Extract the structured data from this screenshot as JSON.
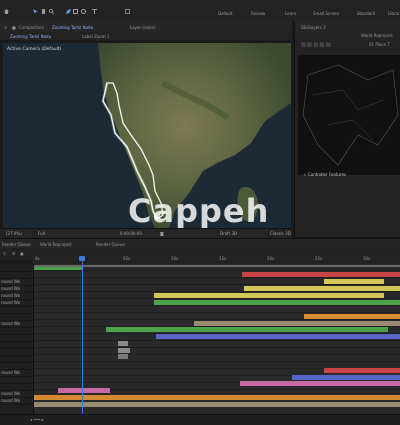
{
  "toolbar": {
    "tools": [
      "home-icon",
      "selection-icon",
      "hand-icon",
      "zoom-icon",
      "rotate-icon",
      "camera-icon",
      "pan-icon",
      "pen-icon",
      "rectangle-icon",
      "text-icon"
    ],
    "default_label": "Default",
    "review_label": "Review",
    "learn_label": "Learn",
    "small_screen_label": "Small Screen",
    "standard_label": "Standard",
    "libraries_label": "Librar"
  },
  "composition": {
    "tab_label": "Composition",
    "comp_name": "Zooming Tamil Nadu",
    "subtab_1": "Zooming Tamil Nadu",
    "subtab_2": "Label Zoom 1",
    "layer_tab": "Layer (none)",
    "viewer_label": "Active Camera (Default)"
  },
  "viewer_footer": {
    "zoom": "(27.9%)",
    "resolution": "Full",
    "timecode": "0:00:00:00",
    "camera": "Draft 3D",
    "view": "Classic 3D"
  },
  "right_panel": {
    "tab_label": "GEOlayers 3",
    "place_label": "01 Place T",
    "world_label": "World Reproject",
    "feature_label": "Controller Features"
  },
  "watermark": "Cappeh",
  "timeline": {
    "tab_1": "Render Queue",
    "tab_2": "World Reproject",
    "tab_3": "Render Queue",
    "ticks": [
      "0s",
      "05s",
      "10s",
      "15s",
      "20s",
      "25s",
      "30s",
      "35s"
    ],
    "layers": [
      "",
      "",
      "round Wo",
      "round Wo",
      "round Wo",
      "round Wo",
      "",
      "",
      "round Wo",
      "",
      "",
      "",
      "",
      "",
      "",
      "round Wo",
      "",
      "",
      "round Wo",
      "round Wo"
    ]
  },
  "colors": {
    "accent": "#3a7bd5",
    "panel": "#232323",
    "track": "#292929",
    "coastline": "#ffffff",
    "bar_green": "#4aa24a",
    "bar_red": "#c94545",
    "bar_yellow": "#d2c85a",
    "bar_blue": "#5865c8",
    "bar_orange": "#d58a2f",
    "bar_pink": "#c86aa7",
    "bar_tan": "#9a8a70"
  }
}
